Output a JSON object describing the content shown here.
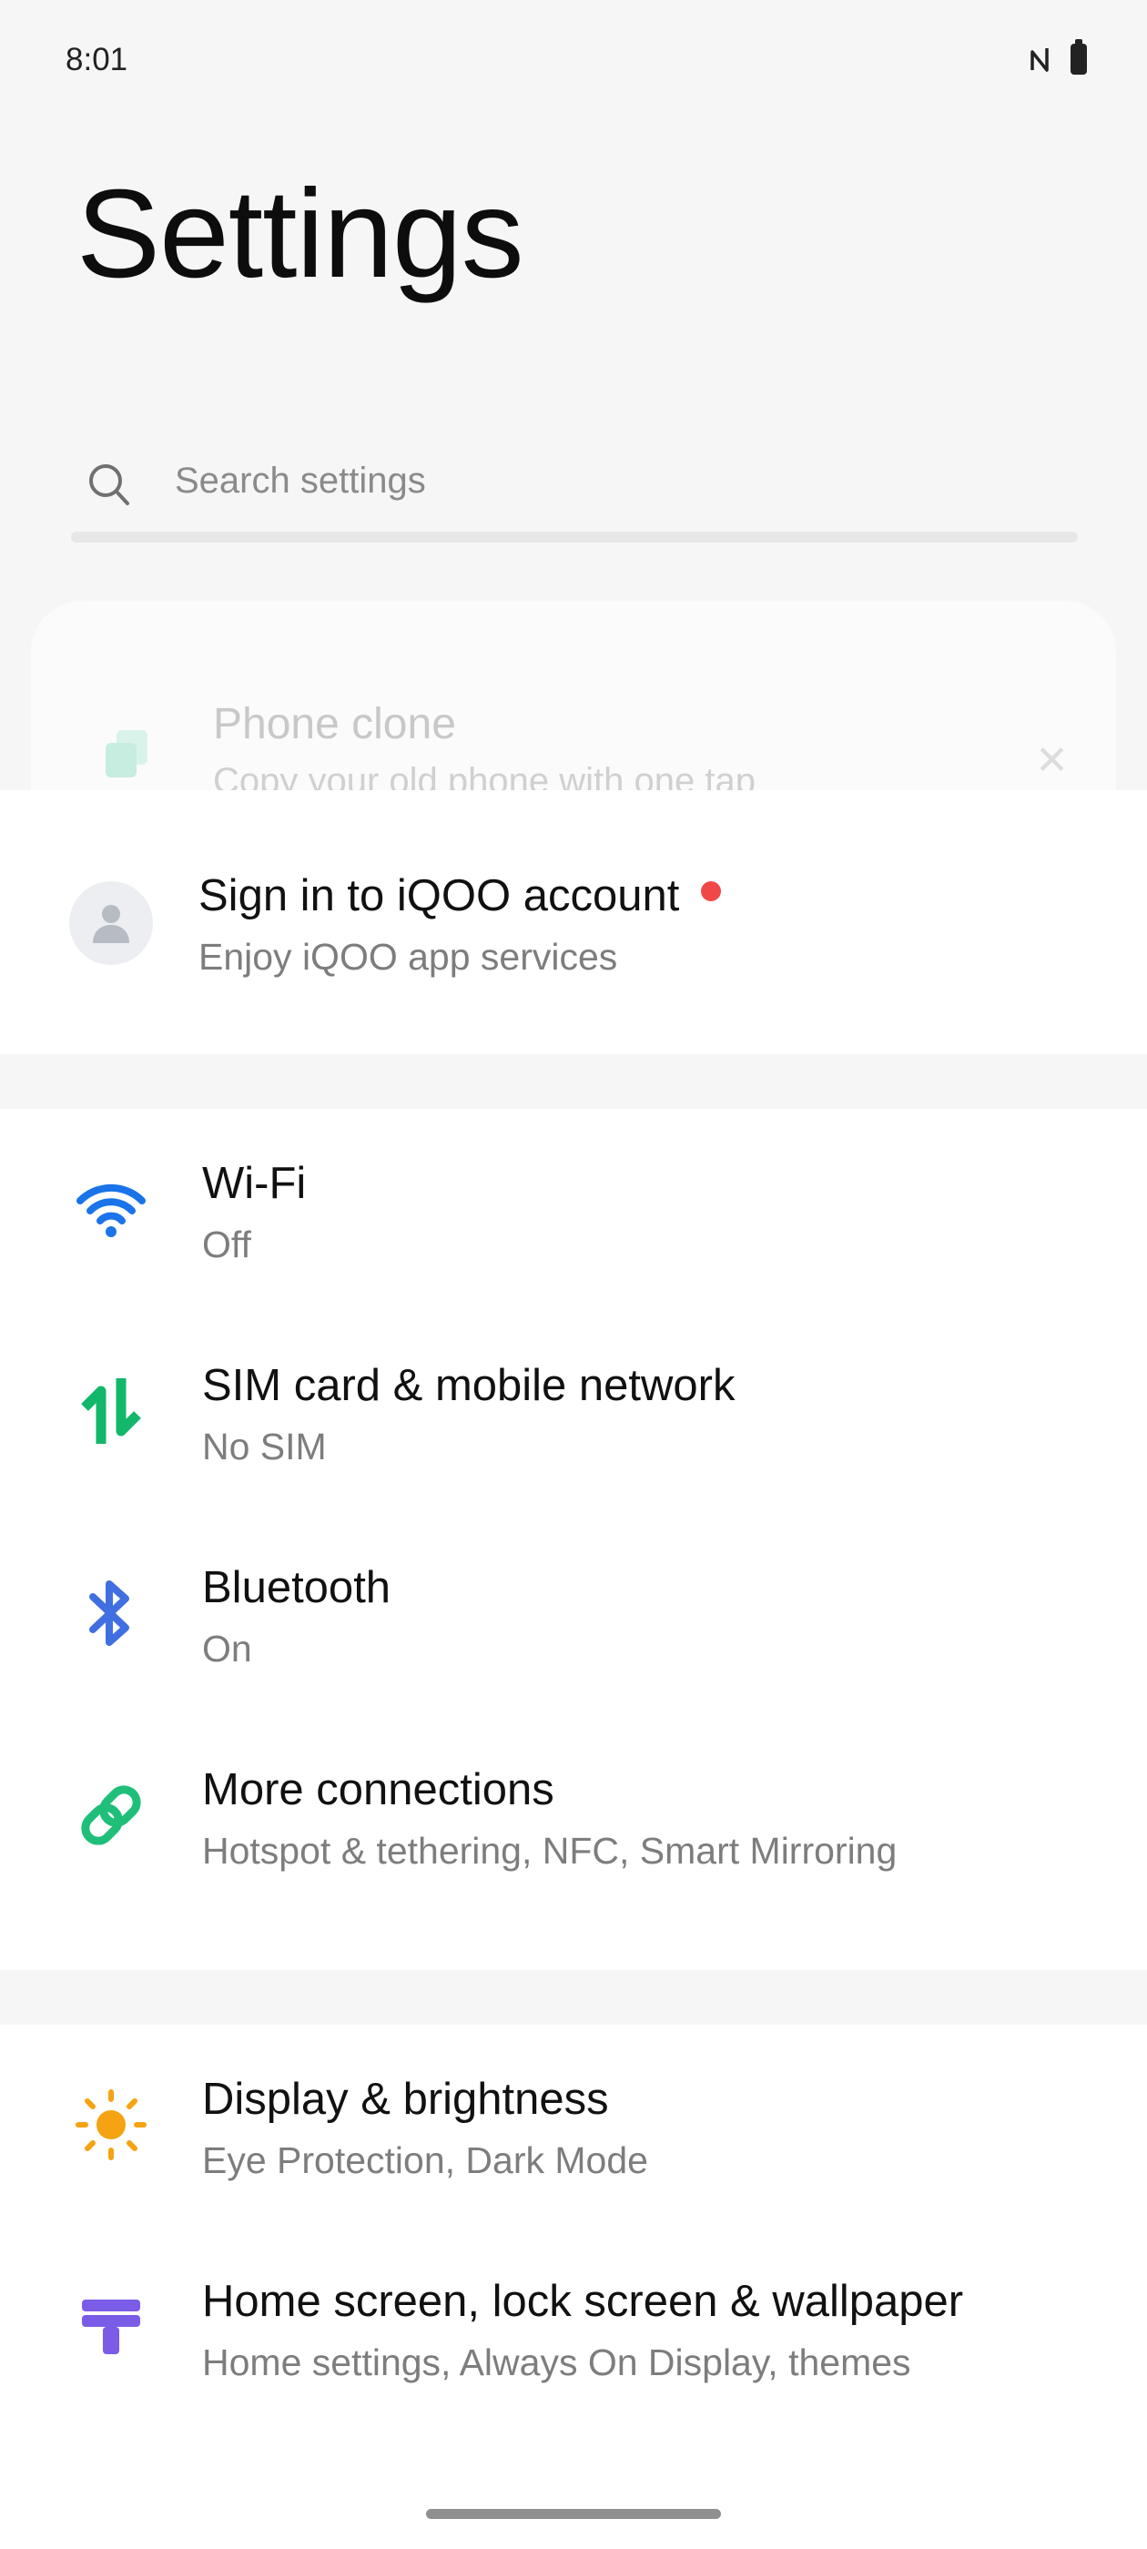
{
  "status_bar": {
    "time": "8:01",
    "icons": [
      "nfc-icon",
      "battery-icon"
    ]
  },
  "page": {
    "title": "Settings"
  },
  "search": {
    "placeholder": "Search settings"
  },
  "phone_clone": {
    "title": "Phone clone",
    "subtitle": "Copy your old phone with one tap"
  },
  "account": {
    "title": "Sign in to iQOO account",
    "subtitle": "Enjoy iQOO app services"
  },
  "connectivity": [
    {
      "title": "Wi-Fi",
      "subtitle": "Off",
      "icon": "wifi-icon",
      "color": "#1a73e8"
    },
    {
      "title": "SIM card & mobile network",
      "subtitle": "No SIM",
      "icon": "mobile-data-icon",
      "color": "#12b76a"
    },
    {
      "title": "Bluetooth",
      "subtitle": "On",
      "icon": "bluetooth-icon",
      "color": "#3f6fe0"
    },
    {
      "title": "More connections",
      "subtitle": "Hotspot & tethering, NFC, Smart Mirroring",
      "icon": "link-icon",
      "color": "#1fbf7a"
    }
  ],
  "personalization": [
    {
      "title": "Display & brightness",
      "subtitle": "Eye Protection, Dark Mode",
      "icon": "sun-icon",
      "color": "#f5a312"
    },
    {
      "title": "Home screen, lock screen & wallpaper",
      "subtitle": "Home settings, Always On Display, themes",
      "icon": "brush-icon",
      "color": "#7b5ce6"
    }
  ],
  "colors": {
    "accent_red": "#f04848",
    "background": "#f6f6f6"
  }
}
